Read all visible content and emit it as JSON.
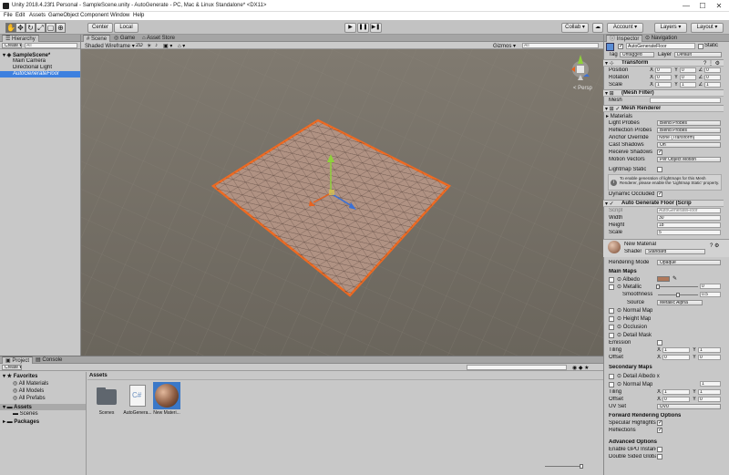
{
  "window": {
    "title": "Unity 2018.4.23f1 Personal - SampleScene.unity - AutoGenerate - PC, Mac & Linux Standalone* <DX11>",
    "minimize": "—",
    "maximize": "☐",
    "close": "✕"
  },
  "menu": [
    "File",
    "Edit",
    "Assets",
    "GameObject",
    "Component",
    "Window",
    "Help"
  ],
  "toolbar": {
    "pivot": "Center",
    "space": "Local",
    "collab": "Collab",
    "account": "Account",
    "layers": "Layers",
    "layout": "Layout"
  },
  "hierarchy": {
    "tab": "Hierarchy",
    "create": "Create",
    "search_placeholder": "All",
    "scene": "SampleScene*",
    "items": [
      "Main Camera",
      "Directional Light",
      "AutoGenerateFloor"
    ]
  },
  "scene_view": {
    "tabs": [
      "Scene",
      "Game",
      "Asset Store"
    ],
    "shading": "Shaded Wireframe",
    "mode_2d": "2D",
    "gizmos": "Gizmos",
    "search_placeholder": "All",
    "persp": "< Persp",
    "grid_color": "#5e5a52",
    "plane_fill": "#b09283",
    "plane_outline": "#ee6a22"
  },
  "inspector": {
    "tabs": [
      "Inspector",
      "Navigation"
    ],
    "object_name": "AutoGenerateFloor",
    "static": "Static",
    "tag_label": "Tag",
    "tag": "Untagged",
    "layer_label": "Layer",
    "layer": "Default",
    "transform": {
      "title": "Transform",
      "rows": [
        {
          "label": "Position",
          "x": "0",
          "y": "0",
          "z": "0"
        },
        {
          "label": "Rotation",
          "x": "0",
          "y": "0",
          "z": "0"
        },
        {
          "label": "Scale",
          "x": "1",
          "y": "1",
          "z": "1"
        }
      ]
    },
    "mesh_filter": {
      "title": "(Mesh Filter)",
      "mesh_label": "Mesh",
      "mesh": ""
    },
    "mesh_renderer": {
      "title": "Mesh Renderer",
      "materials": "Materials",
      "rows": [
        {
          "label": "Light Probes",
          "value": "Blend Probes"
        },
        {
          "label": "Reflection Probes",
          "value": "Blend Probes"
        },
        {
          "label": "Anchor Override",
          "value": "None (Transform)"
        },
        {
          "label": "Cast Shadows",
          "value": "On"
        },
        {
          "label": "Receive Shadows",
          "value": "✓"
        },
        {
          "label": "Motion Vectors",
          "value": "Per Object Motion"
        }
      ],
      "lightmap_static": "Lightmap Static",
      "info": "To enable generation of lightmaps for this Mesh Renderer, please enable the 'Lightmap Static' property.",
      "dynamic_occluded": "Dynamic Occluded"
    },
    "script_comp": {
      "title": "Auto Generate Floor (Scrip",
      "rows": [
        {
          "label": "Script",
          "value": "AutoGenerateFloor"
        },
        {
          "label": "Width",
          "value": "30"
        },
        {
          "label": "Height",
          "value": "18"
        },
        {
          "label": "Scale",
          "value": "5"
        }
      ]
    },
    "material": {
      "name": "New Material",
      "shader_label": "Shader",
      "shader": "Standard",
      "rendering_mode_label": "Rendering Mode",
      "rendering_mode": "Opaque",
      "main_maps": "Main Maps",
      "albedo": "Albedo",
      "metallic": "Metallic",
      "metallic_value": "0",
      "smoothness": "Smoothness",
      "smoothness_value": "0.5",
      "source": "Source",
      "source_value": "Metallic Alpha",
      "normal_map": "Normal Map",
      "height_map": "Height Map",
      "occlusion": "Occlusion",
      "detail_mask": "Detail Mask",
      "emission": "Emission",
      "tiling": "Tiling",
      "offset": "Offset",
      "tiling_x": "1",
      "tiling_y": "1",
      "offset_x": "0",
      "offset_y": "0",
      "secondary_maps": "Secondary Maps",
      "detail_albedo": "Detail Albedo x",
      "normal_map2": "Normal Map",
      "normal_map2_value": "1",
      "tiling2_x": "1",
      "tiling2_y": "1",
      "offset2_x": "0",
      "offset2_y": "0",
      "uv_set_label": "UV Set",
      "uv_set": "UV0",
      "forward_rendering": "Forward Rendering Options",
      "specular_highlights": "Specular Highlights",
      "reflections": "Reflections",
      "advanced": "Advanced Options",
      "gpu_instancing": "Enable GPU Instanci",
      "double_sided": "Double Sided Global",
      "albedo_color": "#b0785a"
    }
  },
  "project": {
    "tabs": [
      "Project",
      "Console"
    ],
    "create": "Create",
    "favorites": "Favorites",
    "fav_items": [
      "All Materials",
      "All Models",
      "All Prefabs"
    ],
    "assets": "Assets",
    "asset_sub": [
      "Scenes"
    ],
    "packages": "Packages",
    "breadcrumb": "Assets",
    "files": [
      {
        "label": "Scenes",
        "icon": "folder-icon"
      },
      {
        "label": "AutoGenera...",
        "icon": "csharp-script-icon",
        "glyph": "C#"
      },
      {
        "label": "New Materi...",
        "icon": "material-sphere-icon"
      }
    ]
  }
}
